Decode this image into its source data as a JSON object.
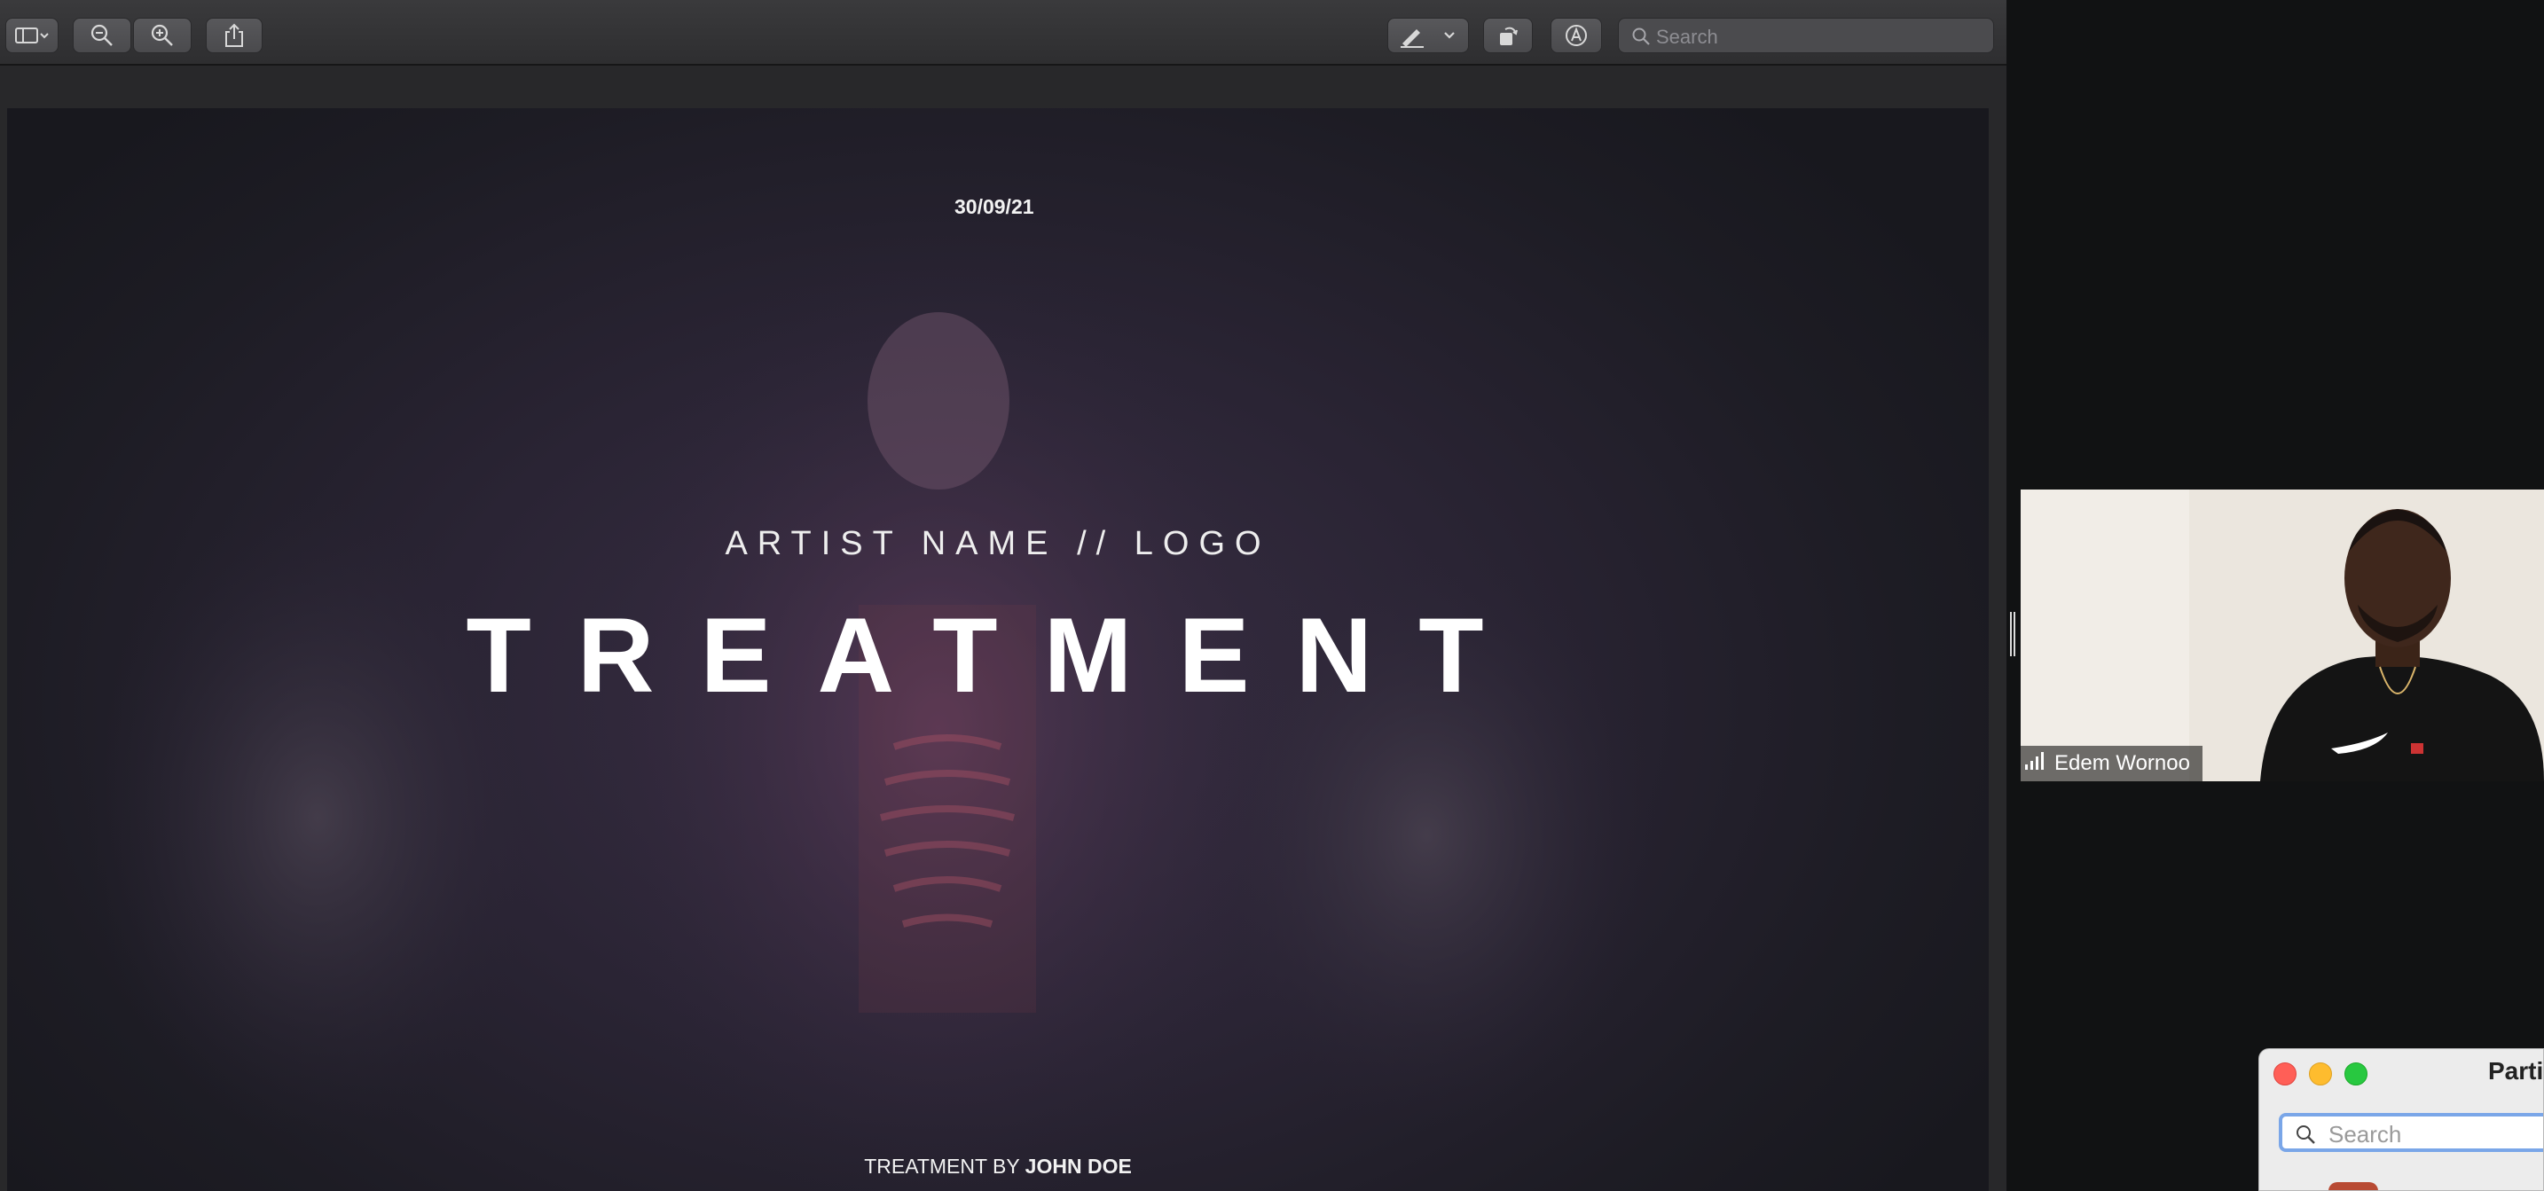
{
  "preview": {
    "search_placeholder": "Search",
    "slide": {
      "date": "30/09/21",
      "artist": "ARTIST NAME // LOGO",
      "title": "TREATMENT",
      "credit_prefix": "TREATMENT BY",
      "credit_name": "JOHN DOE"
    }
  },
  "video": {
    "participant_name": "Edem Wornoo"
  },
  "participants_window": {
    "title": "Parti",
    "search_placeholder": "Search"
  },
  "colors": {
    "close": "#ff5f57",
    "minimize": "#febc2e",
    "zoom": "#28c840",
    "search_focus": "#7aa6e8"
  },
  "icons": [
    "sidebar-icon",
    "zoom-out-icon",
    "zoom-in-icon",
    "share-icon",
    "markup-pen-icon",
    "rotate-icon",
    "annotate-icon",
    "search-icon",
    "signal-icon"
  ]
}
